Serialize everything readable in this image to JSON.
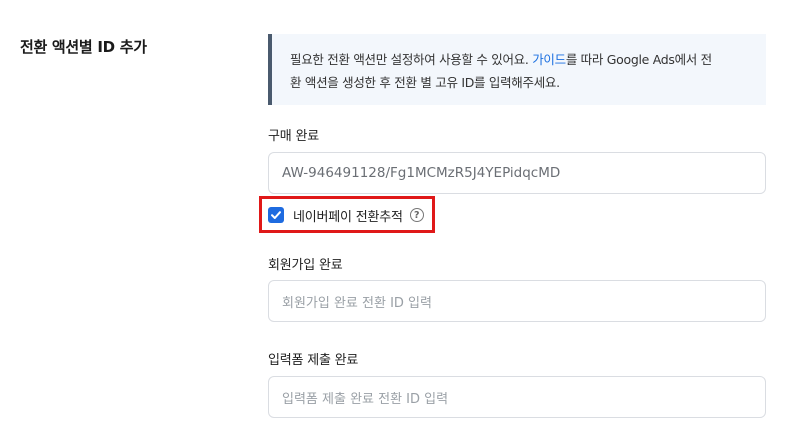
{
  "section": {
    "title": "전환 액션별 ID 추가"
  },
  "info": {
    "text_before": "필요한 전환 액션만 설정하여 사용할 수 있어요.  ",
    "link": "가이드",
    "text_after_line1": "를 따라 Google Ads에서 전",
    "line2": "환 액션을 생성한 후 전환 별 고유 ID를 입력해주세요."
  },
  "fields": [
    {
      "label": "구매 완료",
      "value": "AW-946491128/Fg1MCMzR5J4YEPidqcMD",
      "placeholder": ""
    },
    {
      "label": "회원가입 완료",
      "value": "",
      "placeholder": "회원가입 완료 전환 ID 입력"
    },
    {
      "label": "입력폼 제출 완료",
      "value": "",
      "placeholder": "입력폼 제출 완료 전환 ID 입력"
    }
  ],
  "naver_pay": {
    "label": "네이버페이 전환추적",
    "checked": true,
    "help_glyph": "?"
  },
  "colors": {
    "checkbox": "#1e6be0",
    "link": "#1a6fe0",
    "highlight": "#e01818",
    "info_bg": "#f3f7fc",
    "info_bar": "#4a5a6e"
  }
}
